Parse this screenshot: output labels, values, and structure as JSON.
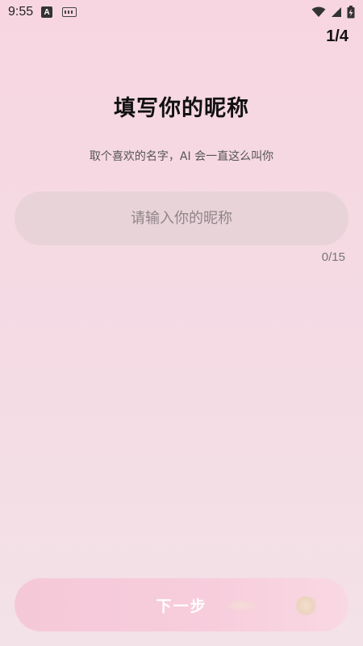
{
  "status_bar": {
    "time": "9:55",
    "icons": [
      "a-notification-icon",
      "keyboard-icon",
      "wifi-icon",
      "signal-icon",
      "battery-charging-icon"
    ]
  },
  "header": {
    "step": "1/4"
  },
  "main": {
    "title": "填写你的昵称",
    "subtitle": "取个喜欢的名字，AI 会一直这么叫你",
    "nickname_input": {
      "placeholder": "请输入你的昵称",
      "value": ""
    },
    "char_counter": "0/15"
  },
  "footer": {
    "next_label": "下一步"
  },
  "colors": {
    "background_top": "#f7d6e1",
    "input_bg": "#e8d3d9",
    "button_bg": "#f5c8d8"
  }
}
